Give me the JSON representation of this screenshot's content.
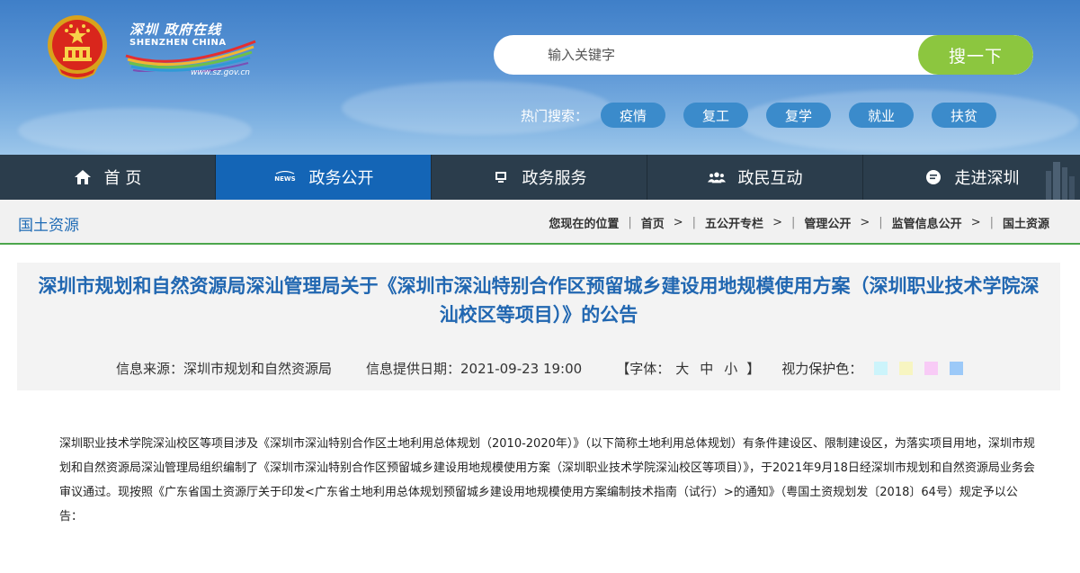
{
  "header": {
    "logo_cn": "深圳 政府在线",
    "logo_en": "SHENZHEN CHINA",
    "logo_site": "www.sz.gov.cn",
    "search": {
      "placeholder": "输入关键字",
      "button": "搜一下"
    },
    "hot_label": "热门搜索：",
    "hot_tags": [
      "疫情",
      "复工",
      "复学",
      "就业",
      "扶贫"
    ]
  },
  "nav": [
    {
      "label": "首 页",
      "icon": "home-icon"
    },
    {
      "label": "政务公开",
      "icon": "news-icon",
      "active": true
    },
    {
      "label": "政务服务",
      "icon": "monitor-icon"
    },
    {
      "label": "政民互动",
      "icon": "people-icon"
    },
    {
      "label": "走进深圳",
      "icon": "chat-icon"
    }
  ],
  "section_title": "国土资源",
  "breadcrumb": {
    "location_label": "您现在的位置",
    "items": [
      "首页",
      "五公开专栏",
      "管理公开",
      "监管信息公开",
      "国土资源"
    ]
  },
  "article": {
    "title": "深圳市规划和自然资源局深汕管理局关于《深圳市深汕特别合作区预留城乡建设用地规模使用方案（深圳职业技术学院深汕校区等项目）》的公告",
    "source": "信息来源：深圳市规划和自然资源局",
    "date": "信息提供日期：2021-09-23 19:00",
    "font_prefix": "【字体：",
    "font_large": "大",
    "font_medium": "中",
    "font_small": "小",
    "font_suffix": "】",
    "eye_label": "视力保护色：",
    "eye_colors": [
      "#ccf4fb",
      "#f7f5c1",
      "#f8cbf6",
      "#9cc9f8"
    ],
    "body": "深圳职业技术学院深汕校区等项目涉及《深圳市深汕特别合作区土地利用总体规划（2010-2020年）》（以下简称土地利用总体规划）有条件建设区、限制建设区，为落实项目用地，深圳市规划和自然资源局深汕管理局组织编制了《深圳市深汕特别合作区预留城乡建设用地规模使用方案（深圳职业技术学院深汕校区等项目）》，于2021年9月18日经深圳市规划和自然资源局业务会审议通过。现按照《广东省国土资源厅关于印发<广东省土地利用总体规划预留城乡建设用地规模使用方案编制技术指南（试行）>的通知》（粤国土资规划发〔2018〕64号）规定予以公告："
  },
  "colors": {
    "nav_bg": "#2b3d4c",
    "nav_active": "#1465b6",
    "accent_green": "#8cc63f",
    "title_blue": "#2167b1"
  }
}
